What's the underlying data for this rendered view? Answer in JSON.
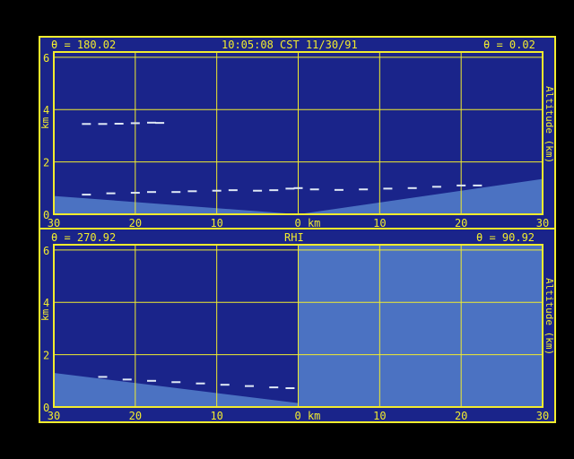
{
  "colors": {
    "background": "#000000",
    "frame": "#1a248a",
    "accent": "#f2ec2e",
    "ground": "#4b72c2",
    "echo": "#dfe8f5"
  },
  "top_panel": {
    "left_angle": "θ = 180.02",
    "center_label": "10:05:08 CST 11/30/91",
    "right_angle": "θ = 0.02",
    "y_unit_label": "km",
    "altitude_label": "Altitude (km)",
    "y_ticks": [
      "0",
      "2",
      "4",
      "6"
    ],
    "x_ticks": [
      "30",
      "20",
      "10",
      "0 km",
      "10",
      "20",
      "30"
    ]
  },
  "bottom_panel": {
    "left_angle": "θ = 270.92",
    "center_label": "RHI",
    "right_angle": "θ = 90.92",
    "y_unit_label": "km",
    "altitude_label": "Altitude (km)",
    "y_ticks": [
      "0",
      "2",
      "4",
      "6"
    ],
    "x_ticks": [
      "30",
      "20",
      "10",
      "0 km",
      "10",
      "20",
      "30"
    ]
  },
  "chart_data": [
    {
      "type": "scatter",
      "title": "",
      "xlabel": "km",
      "ylabel": "Altitude (km)",
      "xlim": [
        -30,
        30
      ],
      "ylim": [
        0,
        6.2
      ],
      "grid": true,
      "ground": [
        {
          "x": -30,
          "y": 0.7
        },
        {
          "x": 0,
          "y": 0
        },
        {
          "x": 30,
          "y": 1.35
        }
      ],
      "series": [
        {
          "values": [
            {
              "x": -26,
              "y": 3.45
            },
            {
              "x": -24,
              "y": 3.45
            },
            {
              "x": -22,
              "y": 3.46
            },
            {
              "x": -20,
              "y": 3.48
            },
            {
              "x": -18,
              "y": 3.5
            },
            {
              "x": -17,
              "y": 3.49
            },
            {
              "x": -26,
              "y": 0.75
            },
            {
              "x": -23,
              "y": 0.8
            },
            {
              "x": -20,
              "y": 0.82
            },
            {
              "x": -18,
              "y": 0.85
            },
            {
              "x": -15,
              "y": 0.85
            },
            {
              "x": -13,
              "y": 0.88
            },
            {
              "x": -10,
              "y": 0.9
            },
            {
              "x": -8,
              "y": 0.92
            },
            {
              "x": -5,
              "y": 0.9
            },
            {
              "x": -3,
              "y": 0.92
            },
            {
              "x": -1,
              "y": 0.98
            },
            {
              "x": 0,
              "y": 1.0
            },
            {
              "x": 2,
              "y": 0.95
            },
            {
              "x": 5,
              "y": 0.93
            },
            {
              "x": 8,
              "y": 0.95
            },
            {
              "x": 11,
              "y": 0.98
            },
            {
              "x": 14,
              "y": 1.0
            },
            {
              "x": 17,
              "y": 1.05
            },
            {
              "x": 20,
              "y": 1.1
            },
            {
              "x": 22,
              "y": 1.1
            }
          ]
        }
      ]
    },
    {
      "type": "scatter",
      "title": "",
      "xlabel": "km",
      "ylabel": "Altitude (km)",
      "xlim": [
        -30,
        30
      ],
      "ylim": [
        0,
        6.2
      ],
      "grid": true,
      "ground": [
        {
          "x": -30,
          "y": 1.3
        },
        {
          "x": 0,
          "y": 0.15
        }
      ],
      "blocked_x_range": [
        0,
        30
      ],
      "series": [
        {
          "values": [
            {
              "x": -24,
              "y": 1.15
            },
            {
              "x": -21,
              "y": 1.05
            },
            {
              "x": -18,
              "y": 1.0
            },
            {
              "x": -15,
              "y": 0.95
            },
            {
              "x": -12,
              "y": 0.9
            },
            {
              "x": -9,
              "y": 0.85
            },
            {
              "x": -6,
              "y": 0.8
            },
            {
              "x": -3,
              "y": 0.75
            },
            {
              "x": -1,
              "y": 0.72
            }
          ]
        }
      ]
    }
  ]
}
